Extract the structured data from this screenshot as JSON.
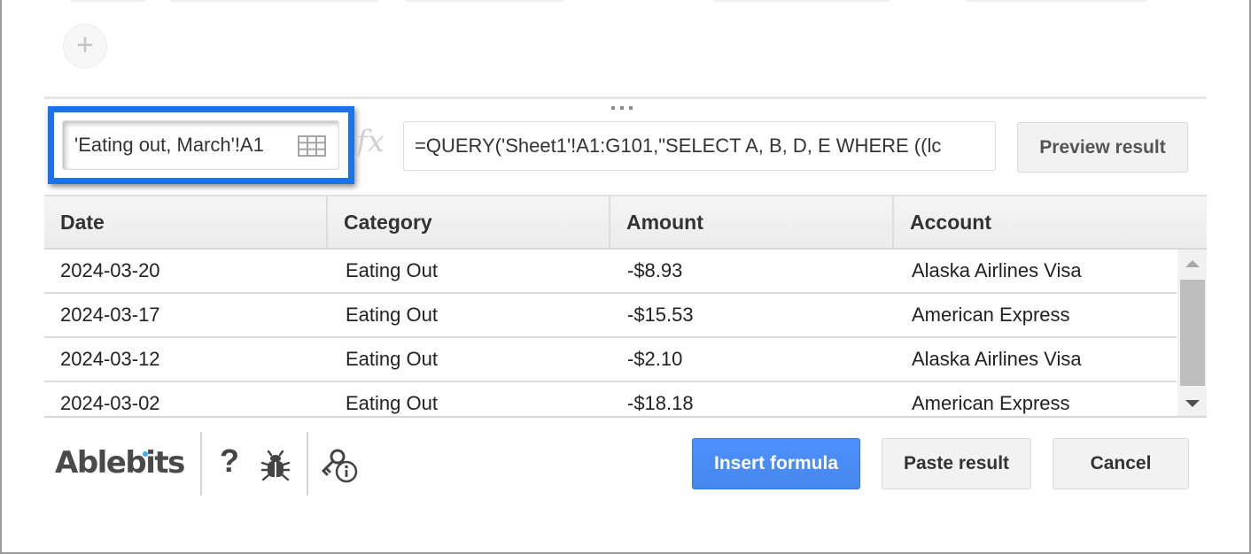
{
  "range_selector": {
    "value": "'Eating out, March'!A1",
    "icon": "grid-icon"
  },
  "formula_bar": {
    "fx_label": "fx",
    "value": "=QUERY('Sheet1'!A1:G101,\"SELECT A, B, D, E WHERE ((lc"
  },
  "toolbar": {
    "add_label": "+",
    "preview_label": "Preview result"
  },
  "table": {
    "columns": [
      "Date",
      "Category",
      "Amount",
      "Account"
    ],
    "rows": [
      [
        "2024-03-20",
        "Eating Out",
        "-$8.93",
        "Alaska Airlines Visa"
      ],
      [
        "2024-03-17",
        "Eating Out",
        "-$15.53",
        "American Express"
      ],
      [
        "2024-03-12",
        "Eating Out",
        "-$2.10",
        "Alaska Airlines Visa"
      ],
      [
        "2024-03-02",
        "Eating Out",
        "-$18.18",
        "American Express"
      ]
    ]
  },
  "footer": {
    "brand": "Ablebits",
    "help_label": "?",
    "insert_label": "Insert formula",
    "paste_label": "Paste result",
    "cancel_label": "Cancel"
  },
  "colors": {
    "highlight": "#1a73e8",
    "primary_button": "#4d90fe",
    "brand_dot": "#3fa9f5"
  }
}
